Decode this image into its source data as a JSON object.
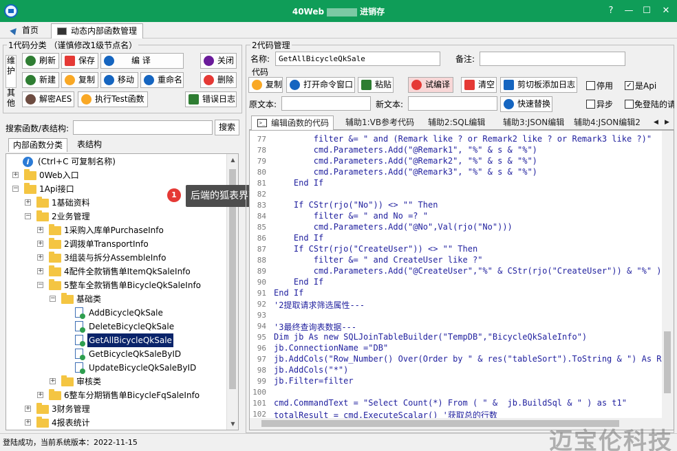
{
  "window": {
    "title_left": "40Web",
    "title_right": "进销存",
    "buttons": {
      "help": "?",
      "minimize": "—",
      "maximize": "☐",
      "close": "✕"
    }
  },
  "tabs": [
    {
      "label": "首页"
    },
    {
      "label": "动态内部函数管理"
    }
  ],
  "left": {
    "group1_label": "1代码分类 （谨慎修改1级节点名）",
    "side_tabs": [
      "维护",
      "其他"
    ],
    "buttons": {
      "refresh": "刷新",
      "save": "保存",
      "compile": "编 译",
      "close": "关闭",
      "new": "新建",
      "copy": "复制",
      "move": "移动",
      "rename": "重命名",
      "delete": "删除",
      "decrypt": "解密AES",
      "exec_test": "执行Test函数",
      "error_log": "错误日志"
    },
    "search_label": "搜索函数/表结构:",
    "search_button": "搜索",
    "search_value": "",
    "subtabs": [
      "内部函数分类",
      "表结构"
    ],
    "tree": [
      {
        "label": "(Ctrl+C 可复制名称)"
      },
      {
        "label": "0Web入口"
      },
      {
        "label": "1Api接口"
      },
      {
        "label": "1基础资料"
      },
      {
        "label": "2业务管理"
      },
      {
        "label": "1采购入库单PurchaseInfo"
      },
      {
        "label": "2调拨单TransportInfo"
      },
      {
        "label": "3组装与拆分AssembleInfo"
      },
      {
        "label": "4配件全款销售单ItemQkSaleInfo"
      },
      {
        "label": "5整车全款销售单BicycleQkSaleInfo"
      },
      {
        "label": "基础类"
      },
      {
        "label": "AddBicycleQkSale"
      },
      {
        "label": "DeleteBicycleQkSale"
      },
      {
        "label": "GetAllBicycleQkSale"
      },
      {
        "label": "GetBicycleQkSaleByID"
      },
      {
        "label": "UpdateBicycleQkSaleByID"
      },
      {
        "label": "审核类"
      },
      {
        "label": "6整车分期销售单BicycleFqSaleInfo"
      },
      {
        "label": "3财务管理"
      },
      {
        "label": "4报表统计"
      }
    ],
    "tooltip": {
      "number": "1",
      "text": "后端的狐表界面"
    }
  },
  "right": {
    "group2_label": "2代码管理",
    "name_label": "名称:",
    "name_value": "GetAllBicycleQkSale",
    "remark_label": "备注:",
    "remark_value": "",
    "code_label": "代码",
    "buttons": {
      "copy": "复制",
      "open_cmd": "打开命令窗口",
      "paste": "粘贴",
      "test_compile": "试编译",
      "clear": "清空",
      "clipboard_log": "剪切板添加日志",
      "quick_replace": "快速替换"
    },
    "checks": {
      "disable": {
        "label": "停用",
        "checked": false
      },
      "is_api": {
        "label": "是Api",
        "checked": true
      },
      "async": {
        "label": "异步",
        "checked": false
      },
      "no_login": {
        "label": "免登陆的请",
        "checked": false
      }
    },
    "orig_label": "原文本:",
    "new_label": "新文本:",
    "code_tabs": [
      "编辑函数的代码",
      "辅助1:VB参考代码",
      "辅助2:SQL编辑",
      "辅助3:JSON编辑",
      "辅助4:JSON编辑2"
    ],
    "code_lines": [
      {
        "n": "77",
        "t": "        filter &= \" and (Remark like ? or Remark2 like ? or Remark3 like ?)\""
      },
      {
        "n": "78",
        "t": "        cmd.Parameters.Add(\"@Remark1\", \"%\" & s & \"%\")"
      },
      {
        "n": "79",
        "t": "        cmd.Parameters.Add(\"@Remark2\", \"%\" & s & \"%\")"
      },
      {
        "n": "80",
        "t": "        cmd.Parameters.Add(\"@Remark3\", \"%\" & s & \"%\")"
      },
      {
        "n": "81",
        "t": "    End If"
      },
      {
        "n": "82",
        "t": ""
      },
      {
        "n": "83",
        "t": "    If CStr(rjo(\"No\")) <> \"\" Then"
      },
      {
        "n": "84",
        "t": "        filter &= \" and No =? \""
      },
      {
        "n": "85",
        "t": "        cmd.Parameters.Add(\"@No\",Val(rjo(\"No\")))"
      },
      {
        "n": "86",
        "t": "    End If"
      },
      {
        "n": "87",
        "t": "    If CStr(rjo(\"CreateUser\")) <> \"\" Then"
      },
      {
        "n": "88",
        "t": "        filter &= \" and CreateUser like ?\""
      },
      {
        "n": "89",
        "t": "        cmd.Parameters.Add(\"@CreateUser\",\"%\" & CStr(rjo(\"CreateUser\")) & \"%\" )"
      },
      {
        "n": "90",
        "t": "    End If"
      },
      {
        "n": "91",
        "t": "End If"
      },
      {
        "n": "92",
        "t": "'2提取请求筛选属性---"
      },
      {
        "n": "93",
        "t": ""
      },
      {
        "n": "94",
        "t": "'3最终查询表数据---"
      },
      {
        "n": "95",
        "t": "Dim jb As new SQLJoinTableBuilder(\"TempDB\",\"BicycleQkSaleInfo\")"
      },
      {
        "n": "96",
        "t": "jb.ConnectionName =\"DB\""
      },
      {
        "n": "97",
        "t": "jb.AddCols(\"Row_Number() Over(Order by \" & res(\"tableSort\").ToString & \") As RowNum\")"
      },
      {
        "n": "98",
        "t": "jb.AddCols(\"*\")"
      },
      {
        "n": "99",
        "t": "jb.Filter=filter"
      },
      {
        "n": "100",
        "t": ""
      },
      {
        "n": "101",
        "t": "cmd.CommandText = \"Select Count(*) From ( \" &  jb.BuildSql & \" ) as t1\""
      },
      {
        "n": "102",
        "t": "totalResult = cmd.ExecuteScalar() '获取总的行数"
      }
    ]
  },
  "status_text": "登陆成功，当前系统版本：2022-11-15",
  "watermark": "迈宝伦科技",
  "colors": {
    "titlebar": "#0f9d58",
    "selected": "#0a246a",
    "code": "#1f1f9e"
  }
}
